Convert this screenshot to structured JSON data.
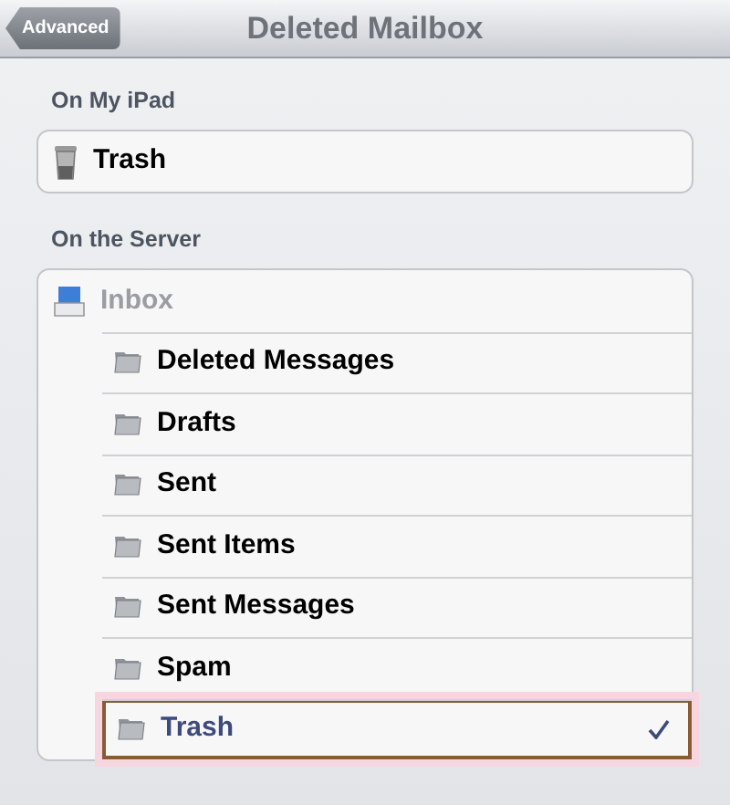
{
  "nav_bar": {
    "back_button": "Advanced",
    "title": "Deleted Mailbox"
  },
  "sections": [
    {
      "header": "On My iPad",
      "mailboxes": [
        {
          "name": "Trash",
          "kind": "trash",
          "selected": false,
          "disabled": false
        }
      ]
    },
    {
      "header": "On the Server",
      "mailboxes": [
        {
          "name": "Inbox",
          "kind": "inbox",
          "selected": false,
          "disabled": true,
          "children": [
            {
              "name": "Deleted Messages",
              "kind": "folder",
              "selected": false,
              "disabled": false
            },
            {
              "name": "Drafts",
              "kind": "folder",
              "selected": false,
              "disabled": false
            },
            {
              "name": "Sent",
              "kind": "folder",
              "selected": false,
              "disabled": false
            },
            {
              "name": "Sent Items",
              "kind": "folder",
              "selected": false,
              "disabled": false
            },
            {
              "name": "Sent Messages",
              "kind": "folder",
              "selected": false,
              "disabled": false
            },
            {
              "name": "Spam",
              "kind": "folder",
              "selected": false,
              "disabled": false
            },
            {
              "name": "Trash",
              "kind": "folder",
              "selected": true,
              "disabled": false
            }
          ]
        }
      ]
    }
  ]
}
